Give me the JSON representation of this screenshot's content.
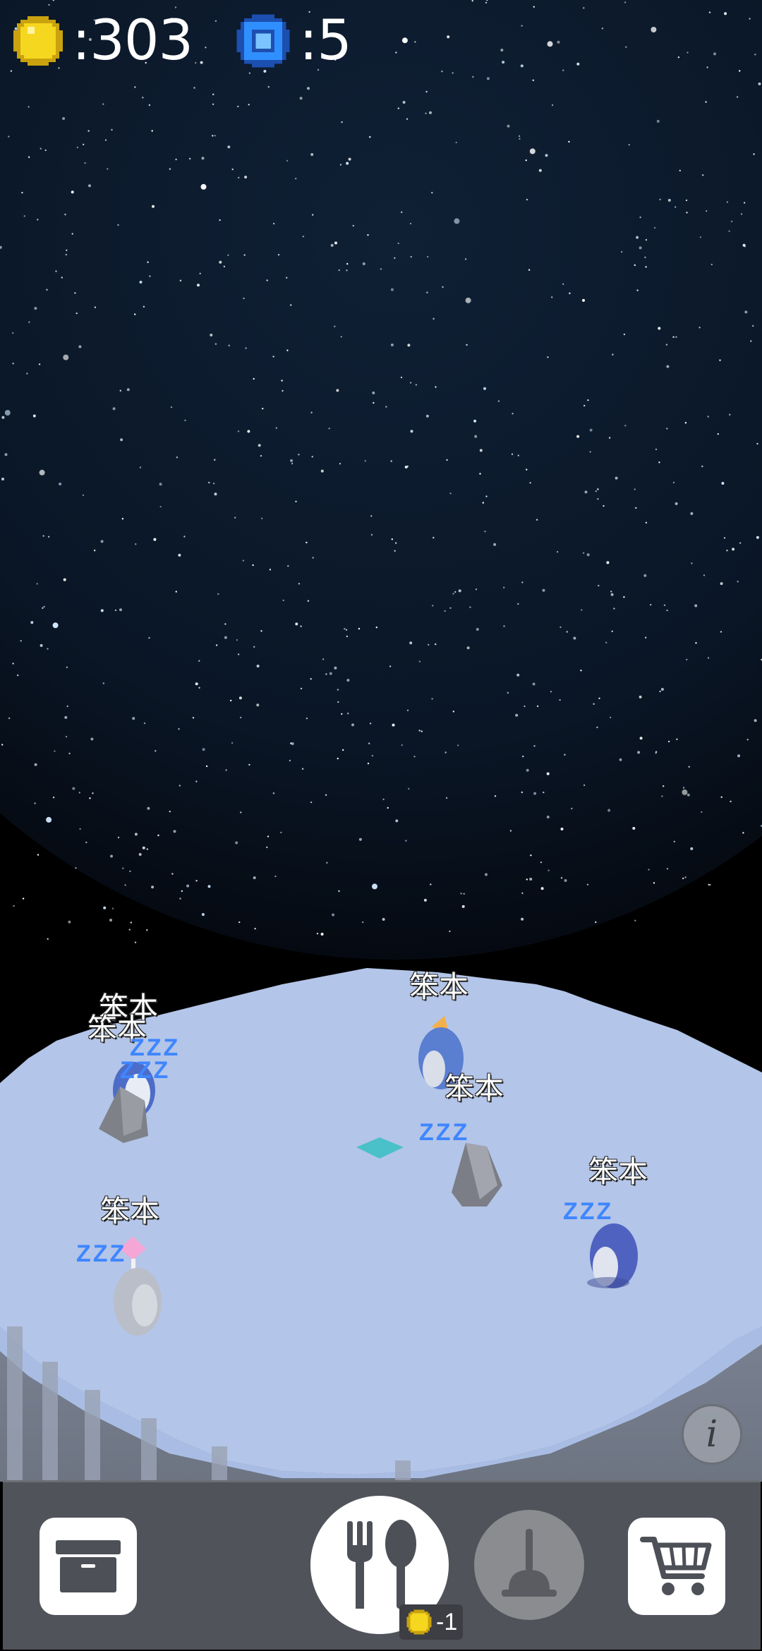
{
  "hud": {
    "coins": ":303",
    "gems": ":5"
  },
  "penguins": [
    {
      "name": "笨本",
      "sleeping": true
    },
    {
      "name": "笨本",
      "sleeping": true
    },
    {
      "name": "笨本",
      "sleeping": false
    },
    {
      "name": "笨本",
      "sleeping": true
    },
    {
      "name": "笨本",
      "sleeping": true
    },
    {
      "name": "笨本",
      "sleeping": true
    }
  ],
  "sleep_text": "ZZZ",
  "toolbar": {
    "feed_cost": "-1",
    "icons": [
      "inventory-box-icon",
      "fork-spoon-icon",
      "plunger-icon",
      "shopping-cart-icon",
      "info-icon",
      "coin-icon"
    ]
  },
  "info_label": "i",
  "colors": {
    "coin": "#f4d41a",
    "gem": "#2f8fff",
    "ice": "#b7c8e8",
    "zzz": "#3f86ff",
    "bar": "#50535a"
  }
}
